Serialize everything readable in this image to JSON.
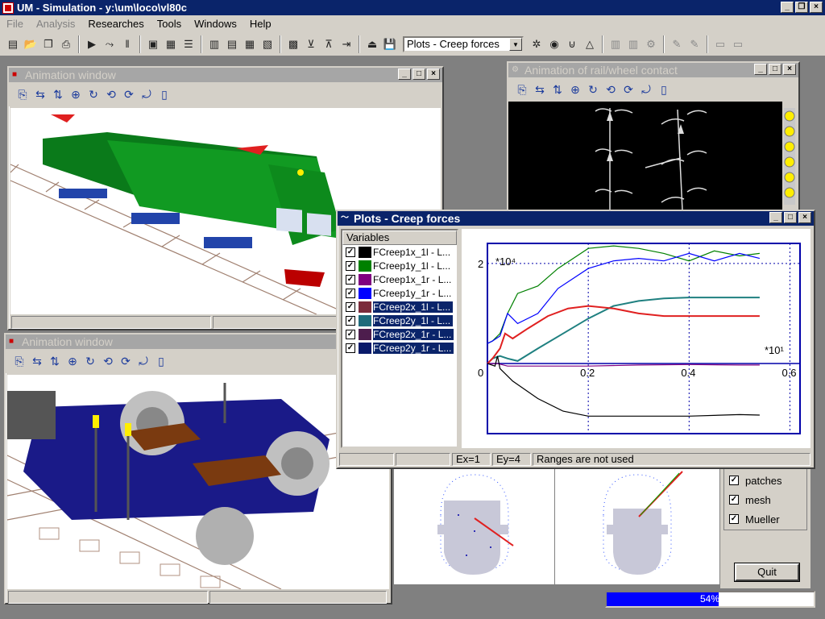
{
  "app": {
    "title": "UM - Simulation - y:\\um\\loco\\vl80c"
  },
  "menu": [
    "File",
    "Analysis",
    "Researches",
    "Tools",
    "Windows",
    "Help"
  ],
  "toolbar": {
    "plot_select": "Plots - Creep forces"
  },
  "anim1": {
    "title": "Animation window"
  },
  "anim2": {
    "title": "Animation window"
  },
  "rail": {
    "title": "Animation of rail/wheel contact"
  },
  "plots": {
    "title": "Plots - Creep forces",
    "vars_header": "Variables",
    "variables": [
      {
        "label": "FCreep1x_1l - L...",
        "color": "#000000"
      },
      {
        "label": "FCreep1y_1l - L...",
        "color": "#008000"
      },
      {
        "label": "FCreep1x_1r - L...",
        "color": "#800080"
      },
      {
        "label": "FCreep1y_1r - L...",
        "color": "#0000ff"
      },
      {
        "label": "FCreep2x_1l - L...",
        "color": "#7b2b3b"
      },
      {
        "label": "FCreep2y_1l - L...",
        "color": "#1f6b7b"
      },
      {
        "label": "FCreep2x_1r - L...",
        "color": "#4d1d4d"
      },
      {
        "label": "FCreep2y_1r - L...",
        "color": "#0a1a6a"
      }
    ],
    "status": {
      "ex": "Ex=1",
      "ey": "Ey=4",
      "ranges": "Ranges are not used"
    }
  },
  "chart_data": {
    "type": "line",
    "x_multiplier": "*10¹",
    "y_multiplier": "*10⁴",
    "xticks": [
      "0",
      "0.2",
      "0.4",
      "0.6"
    ],
    "yticks": [
      "0",
      "2"
    ],
    "xlim": [
      0,
      0.62
    ],
    "ylim": [
      -1.4,
      2.4
    ],
    "series": [
      {
        "color": "#008000",
        "x": [
          0,
          0.01,
          0.025,
          0.04,
          0.06,
          0.1,
          0.14,
          0.2,
          0.25,
          0.3,
          0.35,
          0.4,
          0.45,
          0.5,
          0.54
        ],
        "y": [
          0.4,
          0.45,
          0.6,
          1.0,
          1.4,
          1.55,
          1.9,
          2.3,
          2.35,
          2.3,
          2.2,
          2.05,
          2.25,
          2.15,
          2.2
        ]
      },
      {
        "color": "#0000ff",
        "x": [
          0,
          0.01,
          0.025,
          0.04,
          0.06,
          0.1,
          0.14,
          0.2,
          0.25,
          0.3,
          0.35,
          0.4,
          0.45,
          0.5,
          0.54
        ],
        "y": [
          0.4,
          0.45,
          0.55,
          1.0,
          0.8,
          1.0,
          1.5,
          1.9,
          2.05,
          2.1,
          2.05,
          2.2,
          2.05,
          2.2,
          2.1
        ]
      },
      {
        "color": "#1f8080",
        "x": [
          0,
          0.01,
          0.025,
          0.04,
          0.06,
          0.1,
          0.15,
          0.2,
          0.25,
          0.3,
          0.35,
          0.4,
          0.45,
          0.5,
          0.54
        ],
        "y": [
          0.0,
          0.1,
          0.15,
          0.1,
          0.05,
          0.3,
          0.6,
          0.9,
          1.15,
          1.25,
          1.3,
          1.32,
          1.32,
          1.32,
          1.32
        ]
      },
      {
        "color": "#e02020",
        "x": [
          0,
          0.01,
          0.025,
          0.035,
          0.05,
          0.08,
          0.12,
          0.16,
          0.2,
          0.25,
          0.3,
          0.35,
          0.4,
          0.45,
          0.5,
          0.54
        ],
        "y": [
          0.0,
          0.1,
          0.3,
          0.6,
          0.5,
          0.7,
          0.95,
          1.1,
          1.15,
          1.1,
          1.0,
          0.95,
          0.95,
          0.95,
          0.95,
          0.95
        ]
      },
      {
        "color": "#800080",
        "x": [
          0,
          0.02,
          0.04,
          0.1,
          0.2,
          0.3,
          0.4,
          0.5,
          0.54
        ],
        "y": [
          0.0,
          0.0,
          -0.05,
          -0.05,
          -0.05,
          -0.03,
          -0.02,
          -0.03,
          -0.03
        ]
      },
      {
        "color": "#000000",
        "x": [
          0,
          0.015,
          0.02,
          0.025,
          0.05,
          0.1,
          0.15,
          0.2,
          0.3,
          0.4,
          0.5,
          0.54
        ],
        "y": [
          0.0,
          -0.05,
          0.15,
          -0.1,
          -0.35,
          -0.7,
          -0.95,
          -1.05,
          -1.05,
          -1.05,
          -1.02,
          -1.03
        ]
      }
    ]
  },
  "contact": {
    "checkboxes": [
      "patches",
      "mesh",
      "Mueller"
    ],
    "quit_label": "Quit"
  },
  "progress": {
    "value": 0.54,
    "label": "54%"
  }
}
